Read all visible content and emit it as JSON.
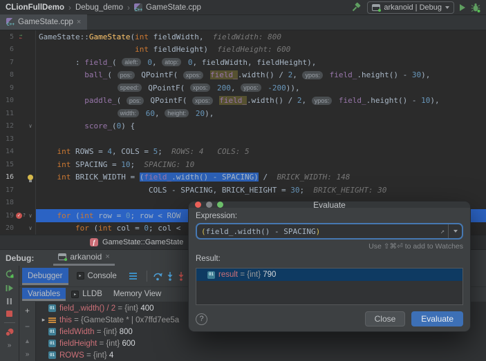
{
  "titlebar": {
    "breadcrumbs": [
      "CLionFullDemo",
      "Debug_demo",
      "GameState.cpp"
    ],
    "separator": "›",
    "run_config": "arkanoid | Debug"
  },
  "editor_tab": {
    "label": "GameState.cpp",
    "close": "×"
  },
  "editor": {
    "lines": [
      {
        "no": "5",
        "icon": "recursion",
        "tokens": [
          [
            "GameState::",
            "pl"
          ],
          [
            "GameState",
            "fn"
          ],
          [
            "(",
            "pl"
          ],
          [
            "int",
            "kw"
          ],
          [
            " fieldWidth,",
            "pl"
          ],
          [
            "  ",
            "pl"
          ],
          [
            "fieldWidth: 800",
            "hint"
          ]
        ]
      },
      {
        "no": "6",
        "tokens": [
          [
            "                     ",
            "pl"
          ],
          [
            "int",
            "kw"
          ],
          [
            " fieldHeight)",
            "pl"
          ],
          [
            "  ",
            "pl"
          ],
          [
            "fieldHeight: 600",
            "hint"
          ]
        ]
      },
      {
        "no": "7",
        "tokens": [
          [
            "        : ",
            "pl"
          ],
          [
            "field_",
            "fd"
          ],
          [
            "( ",
            "pl"
          ],
          [
            "aleft:",
            "pill"
          ],
          [
            " ",
            "pl"
          ],
          [
            "0",
            "nm"
          ],
          [
            ", ",
            "pl"
          ],
          [
            "atop:",
            "pill"
          ],
          [
            " ",
            "pl"
          ],
          [
            "0",
            "nm"
          ],
          [
            ", fieldWidth, fieldHeight),",
            "pl"
          ]
        ]
      },
      {
        "no": "8",
        "tokens": [
          [
            "          ",
            "pl"
          ],
          [
            "ball_",
            "fd"
          ],
          [
            "( ",
            "pl"
          ],
          [
            "pos:",
            "pill"
          ],
          [
            " QPointF( ",
            "pl"
          ],
          [
            "xpos:",
            "pill"
          ],
          [
            " ",
            "pl"
          ],
          [
            "field_",
            "fd hl"
          ],
          [
            ".width() / ",
            "pl"
          ],
          [
            "2",
            "nm"
          ],
          [
            ", ",
            "pl"
          ],
          [
            "ypos:",
            "pill"
          ],
          [
            " ",
            "pl"
          ],
          [
            "field_",
            "fd"
          ],
          [
            ".height() - ",
            "pl"
          ],
          [
            "30",
            "nm"
          ],
          [
            "),",
            "pl"
          ]
        ]
      },
      {
        "no": "9",
        "tokens": [
          [
            "                 ",
            "pl"
          ],
          [
            "speed:",
            "pill"
          ],
          [
            " QPointF( ",
            "pl"
          ],
          [
            "xpos:",
            "pill"
          ],
          [
            " ",
            "pl"
          ],
          [
            "200",
            "nm"
          ],
          [
            ", ",
            "pl"
          ],
          [
            "ypos:",
            "pill"
          ],
          [
            " ",
            "pl"
          ],
          [
            "-200",
            "nm"
          ],
          [
            ")),",
            "pl"
          ]
        ]
      },
      {
        "no": "10",
        "tokens": [
          [
            "          ",
            "pl"
          ],
          [
            "paddle_",
            "fd"
          ],
          [
            "( ",
            "pl"
          ],
          [
            "pos:",
            "pill"
          ],
          [
            " QPointF( ",
            "pl"
          ],
          [
            "xpos:",
            "pill"
          ],
          [
            " ",
            "pl"
          ],
          [
            "field_",
            "fd hl"
          ],
          [
            ".width() / ",
            "pl"
          ],
          [
            "2",
            "nm"
          ],
          [
            ", ",
            "pl"
          ],
          [
            "ypos:",
            "pill"
          ],
          [
            " ",
            "pl"
          ],
          [
            "field_",
            "fd"
          ],
          [
            ".height() - ",
            "pl"
          ],
          [
            "10",
            "nm"
          ],
          [
            "),",
            "pl"
          ]
        ]
      },
      {
        "no": "11",
        "tokens": [
          [
            "                 ",
            "pl"
          ],
          [
            "width:",
            "pill"
          ],
          [
            " ",
            "pl"
          ],
          [
            "60",
            "nm"
          ],
          [
            ", ",
            "pl"
          ],
          [
            "height:",
            "pill"
          ],
          [
            " ",
            "pl"
          ],
          [
            "20",
            "nm"
          ],
          [
            "),",
            "pl"
          ]
        ]
      },
      {
        "no": "12",
        "fold": true,
        "tokens": [
          [
            "          ",
            "pl"
          ],
          [
            "score_",
            "fd"
          ],
          [
            "(",
            "pl"
          ],
          [
            "0",
            "nm"
          ],
          [
            ") {",
            "pl"
          ]
        ]
      },
      {
        "no": "13",
        "tokens": []
      },
      {
        "no": "14",
        "tokens": [
          [
            "    ",
            "pl"
          ],
          [
            "int",
            "kw"
          ],
          [
            " ROWS = ",
            "pl"
          ],
          [
            "4",
            "nm"
          ],
          [
            ", COLS = ",
            "pl"
          ],
          [
            "5",
            "nm"
          ],
          [
            ";",
            "pl"
          ],
          [
            "  ",
            "pl"
          ],
          [
            "ROWS: 4   COLS: 5",
            "hint"
          ]
        ]
      },
      {
        "no": "15",
        "tokens": [
          [
            "    ",
            "pl"
          ],
          [
            "int",
            "kw"
          ],
          [
            " SPACING = ",
            "pl"
          ],
          [
            "10",
            "nm"
          ],
          [
            ";",
            "pl"
          ],
          [
            "  ",
            "pl"
          ],
          [
            "SPACING: 10",
            "hint"
          ]
        ]
      },
      {
        "no": "16",
        "cur": true,
        "bulb": true,
        "tokens": [
          [
            "    ",
            "pl"
          ],
          [
            "int",
            "kw"
          ],
          [
            " BRICK_WIDTH = ",
            "pl"
          ],
          [
            "(",
            "pl sel"
          ],
          [
            "field_",
            "fd sel"
          ],
          [
            ".width() - SPACING)",
            "pl sel"
          ],
          [
            " /",
            "pl"
          ],
          [
            "  ",
            "pl"
          ],
          [
            "BRICK_WIDTH: 148",
            "hint"
          ]
        ]
      },
      {
        "no": "17",
        "tokens": [
          [
            "                        COLS - SPACING, BRICK_HEIGHT = ",
            "pl"
          ],
          [
            "30",
            "nm"
          ],
          [
            ";",
            "pl"
          ],
          [
            "  ",
            "pl"
          ],
          [
            "BRICK_HEIGHT: 30",
            "hint"
          ]
        ]
      },
      {
        "no": "18",
        "tokens": []
      },
      {
        "no": "19",
        "icon": "breakpoint",
        "fold": true,
        "exec": true,
        "tokens": [
          [
            "    ",
            "pl"
          ],
          [
            "for",
            "kw"
          ],
          [
            " (",
            "pl"
          ],
          [
            "int",
            "kw"
          ],
          [
            " row = ",
            "pl"
          ],
          [
            "0",
            "nm"
          ],
          [
            "; row < ROW",
            "pl"
          ]
        ]
      },
      {
        "no": "20",
        "fold": true,
        "tokens": [
          [
            "        ",
            "pl"
          ],
          [
            "for",
            "kw"
          ],
          [
            " (",
            "pl"
          ],
          [
            "int",
            "kw"
          ],
          [
            " col = ",
            "pl"
          ],
          [
            "0",
            "nm"
          ],
          [
            "; col <",
            "pl"
          ]
        ]
      }
    ]
  },
  "breadcrumb_bar": {
    "function_icon": "f",
    "function": "GameState::GameState"
  },
  "debug_panel": {
    "label": "Debug:",
    "session": "arkanoid",
    "session_close": "×",
    "tabs": [
      "Debugger",
      "Console"
    ],
    "subtabs": [
      "Variables",
      "LLDB",
      "Memory View"
    ],
    "watch_toolbar": {
      "add": "+",
      "remove": "−",
      "collapse": "▲",
      "more": "»"
    },
    "controls_more": "»",
    "variables": [
      {
        "icon": "prim",
        "expand": "",
        "name": "field_.width() / 2",
        "meta": " = {int} ",
        "value": "400"
      },
      {
        "icon": "obj",
        "expand": "▸",
        "name": "this",
        "meta": " = {GameState * | 0x7ffd7ee5a",
        "value": ""
      },
      {
        "icon": "prim",
        "expand": "",
        "name": "fieldWidth",
        "meta": " = {int} ",
        "value": "800"
      },
      {
        "icon": "prim",
        "expand": "",
        "name": "fieldHeight",
        "meta": " = {int} ",
        "value": "600"
      },
      {
        "icon": "prim",
        "expand": "",
        "name": "ROWS",
        "meta": " = {int} ",
        "value": "4"
      }
    ]
  },
  "dialog": {
    "title": "Evaluate",
    "expression_label": "Expression:",
    "expression_open": "(",
    "expression_body": "field_.width() - SPACING",
    "expression_close": ")",
    "expand_glyph": "↗",
    "watch_hint": "Use ⇧⌘⏎ to add to Watches",
    "result_label": "Result:",
    "result": {
      "name": "result",
      "meta": " = {int} ",
      "value": "790"
    },
    "help_label": "?",
    "close_label": "Close",
    "evaluate_label": "Evaluate"
  },
  "colors": {
    "accent_blue": "#3d70b6",
    "exec_line": "#2b63c4",
    "selection": "#2b5fb4",
    "breakpoint_red": "#c75450",
    "run_green": "#5f9e60",
    "panel": "#3c3f41",
    "editor_bg": "#2b2b2b"
  }
}
